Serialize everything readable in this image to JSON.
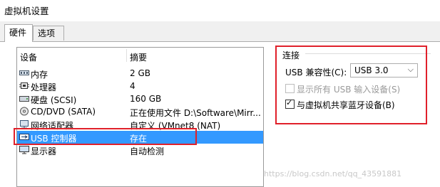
{
  "window": {
    "title": "虚拟机设置"
  },
  "tabs": [
    {
      "label": "硬件",
      "active": true
    },
    {
      "label": "选项",
      "active": false
    }
  ],
  "device_list": {
    "columns": [
      "设备",
      "摘要"
    ],
    "rows": [
      {
        "icon": "memory-icon",
        "name": "内存",
        "summary": "2 GB"
      },
      {
        "icon": "processor-icon",
        "name": "处理器",
        "summary": "4"
      },
      {
        "icon": "hard-disk-icon",
        "name": "硬盘 (SCSI)",
        "summary": "160 GB"
      },
      {
        "icon": "cd-dvd-icon",
        "name": "CD/DVD (SATA)",
        "summary": "正在使用文件 D:\\Software\\Mirr..."
      },
      {
        "icon": "network-adapter-icon",
        "name": "网络适配器",
        "summary": "自定义 (VMnet8 (NAT)"
      },
      {
        "icon": "usb-controller-icon",
        "name": "USB 控制器",
        "summary": "存在",
        "selected": true
      },
      {
        "icon": "display-icon",
        "name": "显示器",
        "summary": "自动检测"
      }
    ]
  },
  "connection": {
    "group_title": "连接",
    "compat_label": "USB 兼容性(C):",
    "compat_value": "USB 3.0",
    "show_all_usb": {
      "label": "显示所有 USB 输入设备(S)",
      "checked": false,
      "disabled": true
    },
    "share_bluetooth": {
      "label": "与虚拟机共享蓝牙设备(B)",
      "checked": true,
      "disabled": false
    }
  },
  "watermark": "https://blog.csdn.net/qq_43591881",
  "colors": {
    "selection": "#3399ff",
    "highlight_box": "#e0202a"
  }
}
